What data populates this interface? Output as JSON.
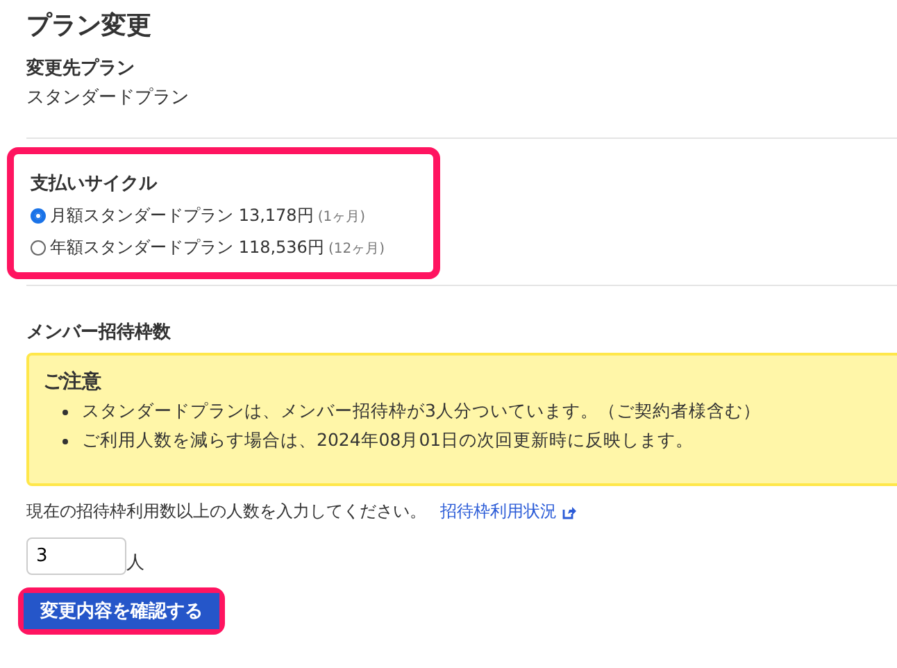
{
  "title": "プラン変更",
  "target_plan": {
    "label": "変更先プラン",
    "value": "スタンダードプラン"
  },
  "payment_cycle": {
    "label": "支払いサイクル",
    "highlighted": true,
    "options": [
      {
        "label": "月額スタンダードプラン 13,178円",
        "note": "(1ヶ月)",
        "selected": true
      },
      {
        "label": "年額スタンダードプラン 118,536円",
        "note": "(12ヶ月)",
        "selected": false
      }
    ]
  },
  "members": {
    "label": "メンバー招待枠数",
    "notice": {
      "title": "ご注意",
      "items": [
        "スタンダードプランは、メンバー招待枠が3人分ついています。（ご契約者様含む）",
        "ご利用人数を減らす場合は、2024年08月01日の次回更新時に反映します。"
      ]
    },
    "instruction": "現在の招待枠利用数以上の人数を入力してください。",
    "link": "招待枠利用状況",
    "value": "3",
    "unit": "人"
  },
  "confirm_button": {
    "label": "変更内容を確認する",
    "highlighted": true
  }
}
